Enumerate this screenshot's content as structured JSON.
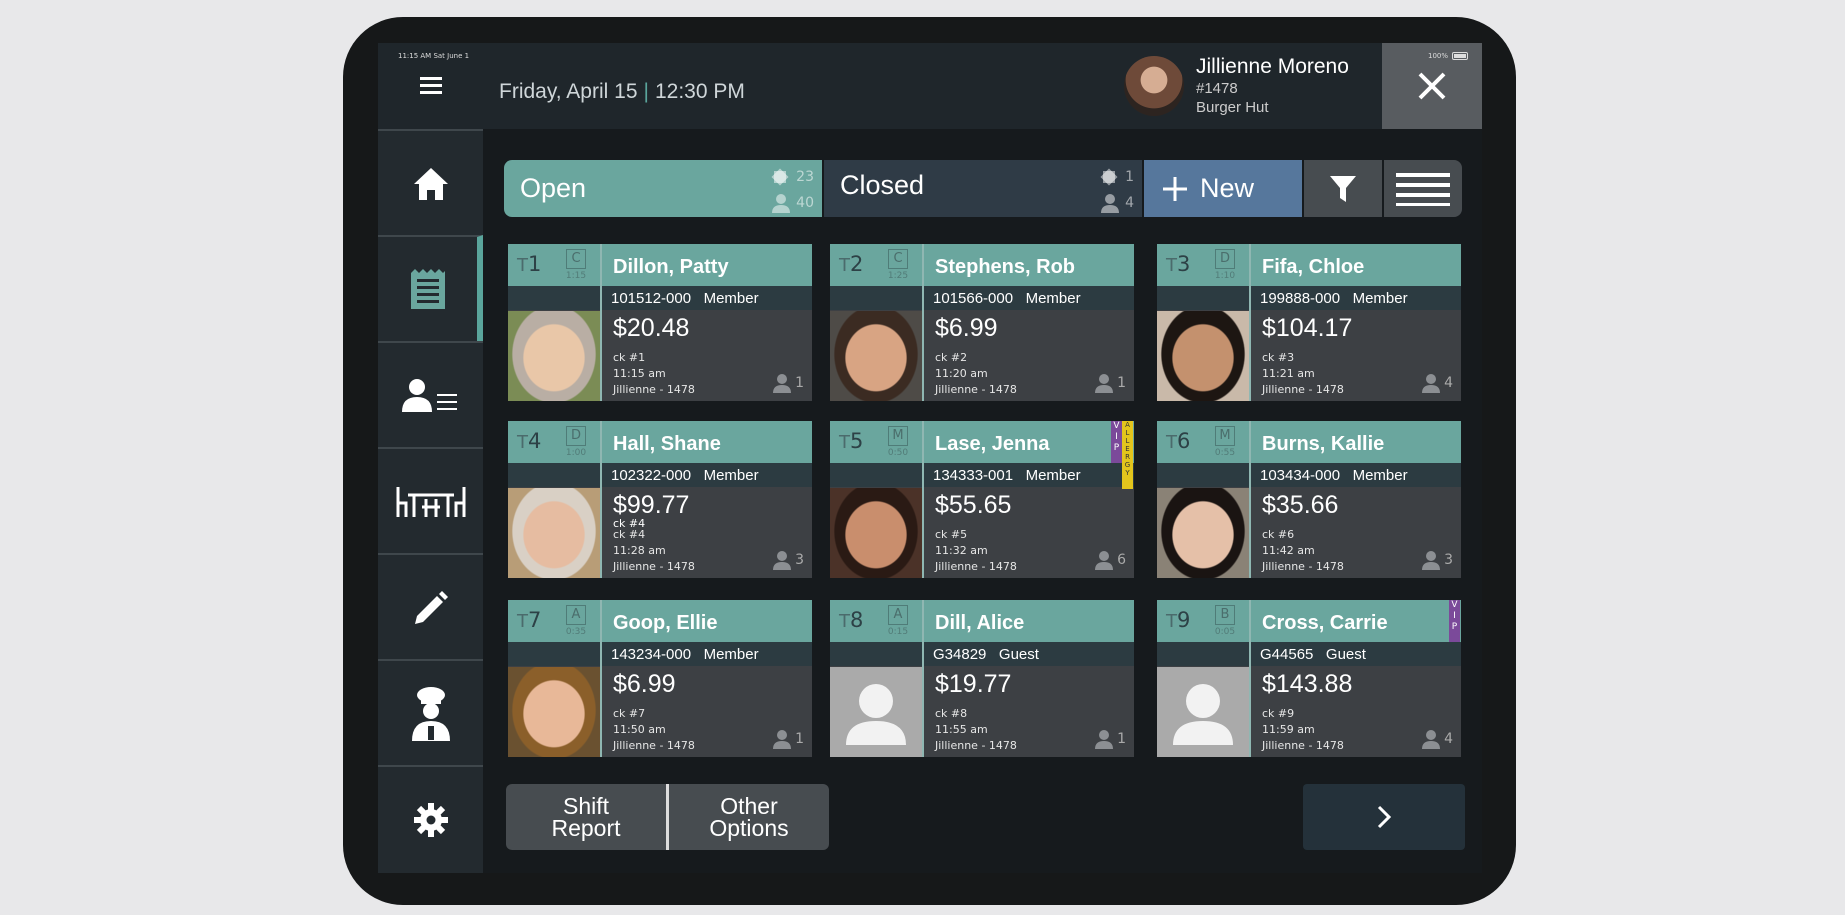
{
  "status_bar": {
    "time": "11:15 AM Sat June 1",
    "battery": "100%"
  },
  "header": {
    "date": "Friday, April 15",
    "separator": "|",
    "time": "12:30 PM",
    "user": {
      "name": "Jillienne Moreno",
      "id": "#1478",
      "location": "Burger Hut"
    }
  },
  "sidebar": {
    "items": [
      "menu-icon",
      "home-icon",
      "receipt-icon",
      "customer-list-icon",
      "tables-icon",
      "edit-icon",
      "chef-icon",
      "settings-icon"
    ],
    "active": "receipt-icon"
  },
  "tabs": {
    "open": {
      "label": "Open",
      "tables": "23",
      "guests": "40"
    },
    "closed": {
      "label": "Closed",
      "tables": "1",
      "guests": "4"
    },
    "new_label": "New"
  },
  "colors": {
    "accent": "#6aa69e",
    "panel": "#3d4044",
    "vip": "#7b4a9a",
    "allergy": "#e3c51c"
  },
  "checks": [
    {
      "t": "T",
      "num": "1",
      "section": "C",
      "timer": "1:15",
      "name": "Dillon, Patty",
      "acct": "101512-000",
      "type": "Member",
      "amount": "$20.48",
      "ck": "ck #1",
      "time": "11:15 am",
      "server": "Jillienne - 1478",
      "guests": "1"
    },
    {
      "t": "T",
      "num": "2",
      "section": "C",
      "timer": "1:25",
      "name": "Stephens, Rob",
      "acct": "101566-000",
      "type": "Member",
      "amount": "$6.99",
      "ck": "ck #2",
      "time": "11:20 am",
      "server": "Jillienne - 1478",
      "guests": "1"
    },
    {
      "t": "T",
      "num": "3",
      "section": "D",
      "timer": "1:10",
      "name": "Fifa, Chloe",
      "acct": "199888-000",
      "type": "Member",
      "amount": "$104.17",
      "ck": "ck #3",
      "time": "11:21 am",
      "server": "Jillienne - 1478",
      "guests": "4"
    },
    {
      "t": "T",
      "num": "4",
      "section": "D",
      "timer": "1:00",
      "name": "Hall, Shane",
      "acct": "102322-000",
      "type": "Member",
      "amount": "$99.77",
      "ck_extra": "ck #4",
      "ck": "ck #4",
      "time": "11:28 am",
      "server": "Jillienne - 1478",
      "guests": "3"
    },
    {
      "t": "T",
      "num": "5",
      "section": "M",
      "timer": "0:50",
      "name": "Lase, Jenna",
      "acct": "134333-001",
      "type": "Member",
      "amount": "$55.65",
      "ck": "ck #5",
      "time": "11:32 am",
      "server": "Jillienne - 1478",
      "guests": "6",
      "vip": "VIP",
      "allergy": "ALLERGY"
    },
    {
      "t": "T",
      "num": "6",
      "section": "M",
      "timer": "0:55",
      "name": "Burns, Kallie",
      "acct": "103434-000",
      "type": "Member",
      "amount": "$35.66",
      "ck": "ck #6",
      "time": "11:42 am",
      "server": "Jillienne - 1478",
      "guests": "3"
    },
    {
      "t": "T",
      "num": "7",
      "section": "A",
      "timer": "0:35",
      "name": "Goop, Ellie",
      "acct": "143234-000",
      "type": "Member",
      "amount": "$6.99",
      "ck": "ck #7",
      "time": "11:50 am",
      "server": "Jillienne - 1478",
      "guests": "1"
    },
    {
      "t": "T",
      "num": "8",
      "section": "A",
      "timer": "0:15",
      "name": "Dill, Alice",
      "acct": "G34829",
      "type": "Guest",
      "amount": "$19.77",
      "ck": "ck #8",
      "time": "11:55 am",
      "server": "Jillienne - 1478",
      "guests": "1"
    },
    {
      "t": "T",
      "num": "9",
      "section": "B",
      "timer": "0:05",
      "name": "Cross, Carrie",
      "acct": "G44565",
      "type": "Guest",
      "amount": "$143.88",
      "ck": "ck #9",
      "time": "11:59 am",
      "server": "Jillienne - 1478",
      "guests": "4",
      "vip": "VIP"
    }
  ],
  "footer": {
    "shift_report": "Shift Report",
    "other_options": "Other Options"
  }
}
